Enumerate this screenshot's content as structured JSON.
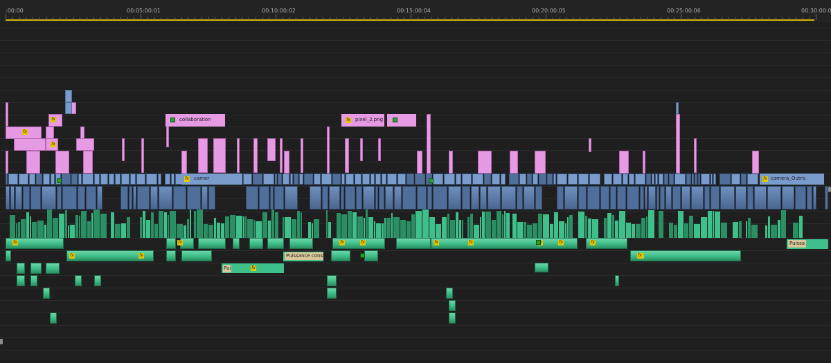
{
  "ruler": {
    "timecodes": [
      ":00:00",
      "00:05:00:01",
      "00:10:00:02",
      "00:15:00:04",
      "00:20:00:05",
      "00:25:00:06",
      "00:30:00:08"
    ]
  },
  "clip_labels": {
    "collaboration": "collaboration",
    "pixel": "pixel_2.png",
    "camer": "camer",
    "camera_outro": "camera_Outro.",
    "puissance": "Puissance constar",
    "puissa": "Puissa",
    "pui": "Pui"
  },
  "fx_glyph": "fx",
  "colors": {
    "background": "#1f1f1f",
    "graphic_clip": "#e59ae3",
    "video_clip": "#7a9ccd",
    "video_clip_dark": "#4f6e9a",
    "audio_clip": "#3fbf8a",
    "audio_clip_dark": "#2a8f63",
    "audio_clip_light": "#6fd6a8",
    "fx_badge": "#e2c600",
    "in_out_bar": "#d9b800",
    "keyframe_green": "#2aa02a"
  }
}
